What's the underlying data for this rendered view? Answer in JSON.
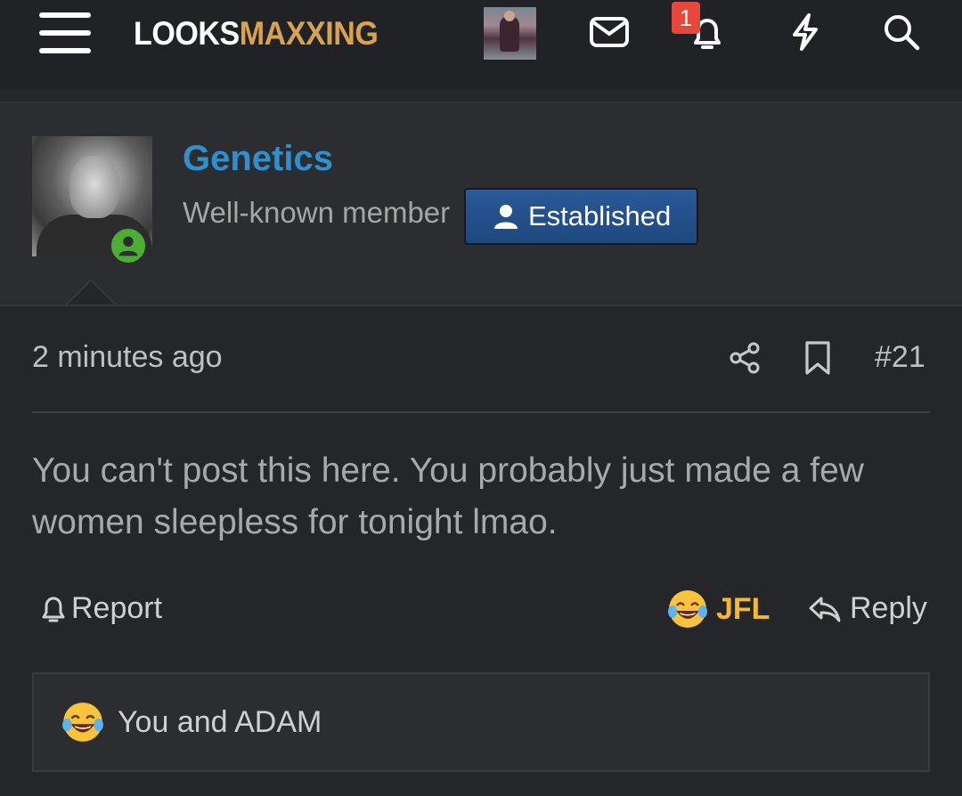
{
  "nav": {
    "logo_part1": "LOOKS",
    "logo_part2": "MAXXING",
    "notification_count": "1",
    "icons": [
      "menu-icon",
      "mail-icon",
      "bell-icon",
      "lightning-icon",
      "search-icon"
    ],
    "accent_color": "#d9a250"
  },
  "post": {
    "author": {
      "name": "Genetics",
      "title": "Well-known member",
      "banner": "Established",
      "status": "online"
    },
    "time": "2 minutes ago",
    "number": "#21",
    "body": "You can't post this here. You probably just made a few women sleepless for tonight lmao.",
    "actions": {
      "report": "Report",
      "reaction": "JFL",
      "reply": "Reply"
    },
    "reactions_summary": "You and ADAM"
  },
  "colors": {
    "username": "#2f8fd0",
    "reaction": "#f5b82e",
    "badge": "#e8473c",
    "banner": "#1e477d"
  }
}
